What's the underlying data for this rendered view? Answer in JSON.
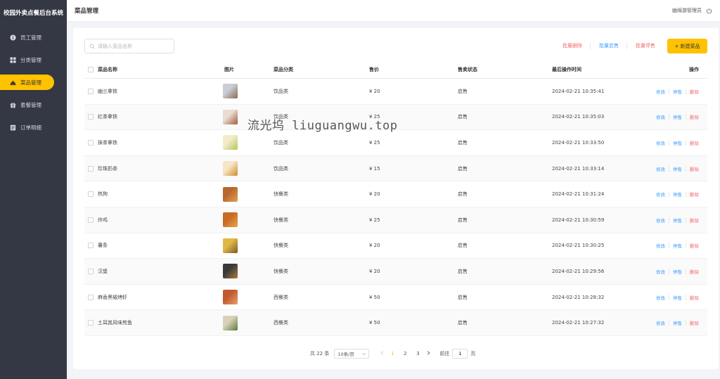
{
  "app": {
    "title": "校园外卖点餐后台系统"
  },
  "sidebar": {
    "items": [
      {
        "label": "员工管理",
        "icon": "user-circle-icon",
        "active": false
      },
      {
        "label": "分类管理",
        "icon": "grid-icon",
        "active": false
      },
      {
        "label": "菜品管理",
        "icon": "dish-cloche-icon",
        "active": true
      },
      {
        "label": "套餐管理",
        "icon": "gift-box-icon",
        "active": false
      },
      {
        "label": "订单明细",
        "icon": "order-list-icon",
        "active": false
      }
    ]
  },
  "header": {
    "title": "菜品管理",
    "user": "幽绵游管理员",
    "logout_icon": "power-icon"
  },
  "toolbar": {
    "search_placeholder": "请输入菜品名称",
    "batch_delete": "批量删除",
    "batch_enable": "批量启售",
    "batch_disable": "批量停售",
    "new_dish": "+ 新建菜品"
  },
  "table": {
    "headers": {
      "name": "菜品名称",
      "image": "图片",
      "category": "菜品分类",
      "price": "售价",
      "status": "售卖状态",
      "time": "最后操作时间",
      "ops": "操作"
    },
    "op_labels": {
      "edit": "修改",
      "toggle": "停售",
      "delete": "删除"
    },
    "rows": [
      {
        "name": "幽兰拿铁",
        "category": "饮品类",
        "price": "¥ 20",
        "status": "启售",
        "time": "2024-02-21 10:35:41",
        "thumb": [
          "#c9cdd6",
          "#8a6a4f"
        ]
      },
      {
        "name": "红茶拿铁",
        "category": "饮品类",
        "price": "¥ 25",
        "status": "启售",
        "time": "2024-02-21 10:35:03",
        "thumb": [
          "#e9dcd2",
          "#a35a3a"
        ]
      },
      {
        "name": "抹茶拿铁",
        "category": "饮品类",
        "price": "¥ 25",
        "status": "启售",
        "time": "2024-02-21 10:33:50",
        "thumb": [
          "#f3ecc9",
          "#b7c45a"
        ]
      },
      {
        "name": "珍珠奶茶",
        "category": "饮品类",
        "price": "¥ 15",
        "status": "启售",
        "time": "2024-02-21 10:33:14",
        "thumb": [
          "#f6e6c8",
          "#d08a2e"
        ]
      },
      {
        "name": "热狗",
        "category": "快餐类",
        "price": "¥ 20",
        "status": "启售",
        "time": "2024-02-21 10:31:24",
        "thumb": [
          "#b8672f",
          "#e2a24a"
        ]
      },
      {
        "name": "炸鸡",
        "category": "快餐类",
        "price": "¥ 25",
        "status": "启售",
        "time": "2024-02-21 10:30:59",
        "thumb": [
          "#c86a22",
          "#e9a64b"
        ]
      },
      {
        "name": "薯条",
        "category": "快餐类",
        "price": "¥ 20",
        "status": "启售",
        "time": "2024-02-21 10:30:25",
        "thumb": [
          "#e2b845",
          "#7a5a2a"
        ]
      },
      {
        "name": "汉堡",
        "category": "快餐类",
        "price": "¥ 20",
        "status": "启售",
        "time": "2024-02-21 10:29:56",
        "thumb": [
          "#3a3a3a",
          "#b07a3a"
        ]
      },
      {
        "name": "麻香黑椒烤虾",
        "category": "西餐类",
        "price": "¥ 50",
        "status": "启售",
        "time": "2024-02-21 10:28:32",
        "thumb": [
          "#c25a2e",
          "#e8a072"
        ]
      },
      {
        "name": "土耳其风味煎鱼",
        "category": "西餐类",
        "price": "¥ 50",
        "status": "启售",
        "time": "2024-02-21 10:27:32",
        "thumb": [
          "#d8d2b8",
          "#5d7a3a"
        ]
      }
    ]
  },
  "pagination": {
    "total_text": "共 22 条",
    "page_size": "10条/页",
    "pages": [
      "1",
      "2",
      "3"
    ],
    "current": "1",
    "goto_label": "前往",
    "goto_value": "1",
    "page_suffix": "页"
  },
  "watermark": "流光坞 liuguangwu.top",
  "colors": {
    "accent": "#ffc200",
    "sidebar_bg": "#343744",
    "link_blue": "#409eff",
    "danger_red": "#f56c6c"
  }
}
